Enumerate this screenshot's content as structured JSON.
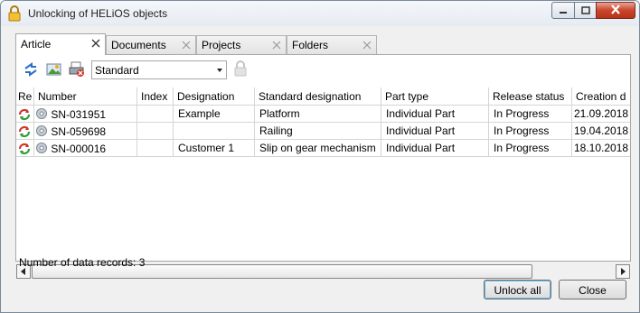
{
  "window": {
    "title": "Unlocking of HELiOS objects"
  },
  "tabs": [
    {
      "label": "Article",
      "active": true
    },
    {
      "label": "Documents",
      "active": false
    },
    {
      "label": "Projects",
      "active": false
    },
    {
      "label": "Folders",
      "active": false
    }
  ],
  "toolbar": {
    "view_select": {
      "value": "Standard"
    }
  },
  "table": {
    "columns": [
      "Re",
      "Number",
      "Index",
      "Designation",
      "Standard designation",
      "Part type",
      "Release status",
      "Creation d"
    ],
    "rows": [
      {
        "number": "SN-031951",
        "index": "",
        "designation": "Example",
        "standard_designation": "Platform",
        "part_type": "Individual Part",
        "release_status": "In Progress",
        "creation_date": "21.09.2018"
      },
      {
        "number": "SN-059698",
        "index": "",
        "designation": "",
        "standard_designation": "Railing",
        "part_type": "Individual Part",
        "release_status": "In Progress",
        "creation_date": "19.04.2018"
      },
      {
        "number": "SN-000016",
        "index": "",
        "designation": "Customer 1",
        "standard_designation": "Slip on gear mechanism",
        "part_type": "Individual Part",
        "release_status": "In Progress",
        "creation_date": "18.10.2018"
      }
    ]
  },
  "status": {
    "record_count_text": "Number of data records: 3"
  },
  "buttons": {
    "unlock_all": "Unlock all",
    "close": "Close"
  },
  "colors": {
    "close_button_red": "#c9442b",
    "accent_blue": "#2a6fc9",
    "icon_green": "#2e9e3a",
    "icon_red": "#d0352b"
  }
}
